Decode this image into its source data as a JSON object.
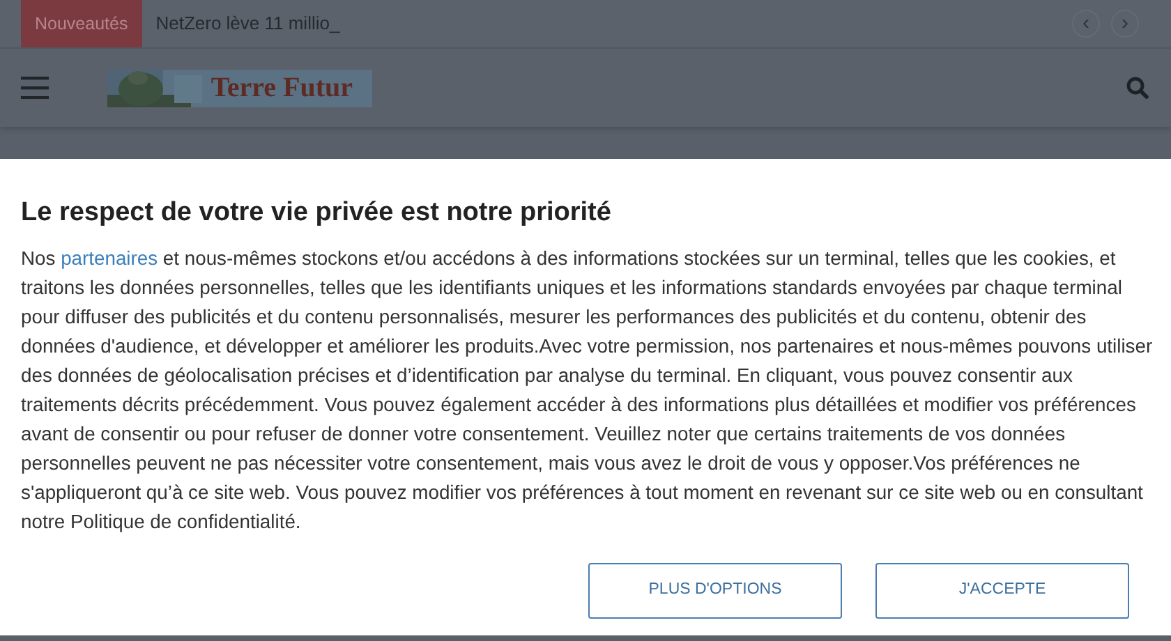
{
  "topbar": {
    "label": "Nouveautés",
    "headline": "NetZero lève 11 millio_",
    "nav_prev": "‹",
    "nav_next": "›"
  },
  "header": {
    "logo_text": "Terre Futur"
  },
  "consent": {
    "title": "Le respect de votre vie privée est notre priorité",
    "text_before_link": "Nos ",
    "link": "partenaires",
    "text_after_link": " et nous-mêmes stockons et/ou accédons à des informations stockées sur un terminal, telles que les cookies, et traitons les données personnelles, telles que les identifiants uniques et les informations standards envoyées par chaque terminal pour diffuser des publicités et du contenu personnalisés, mesurer les performances des publicités et du contenu, obtenir des données d'audience, et développer et améliorer les produits.Avec votre permission, nos partenaires et nous-mêmes pouvons utiliser des données de géolocalisation précises et d’identification par analyse du terminal. En cliquant, vous pouvez consentir aux traitements décrits précédemment. Vous pouvez également accéder à des informations plus détaillées et modifier vos préférences avant de consentir ou pour refuser de donner votre consentement. Veuillez noter que certains traitements de vos données personnelles peuvent ne pas nécessiter votre consentement, mais vous avez le droit de vous y opposer.Vos préférences ne s'appliqueront qu’à ce site web. Vous pouvez modifier vos préférences à tout moment en revenant sur ce site web ou en consultant notre Politique de confidentialité.",
    "buttons": [
      "PLUS D'OPTIONS",
      "J'ACCEPTE"
    ]
  }
}
